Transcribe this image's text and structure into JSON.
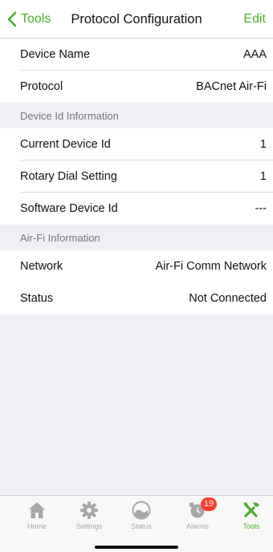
{
  "nav": {
    "back_label": "Tools",
    "title": "Protocol Configuration",
    "edit_label": "Edit"
  },
  "rows_top": [
    {
      "label": "Device Name",
      "value": "AAA"
    },
    {
      "label": "Protocol",
      "value": "BACnet Air-Fi"
    }
  ],
  "device_id_section": {
    "header": "Device Id Information",
    "rows": [
      {
        "label": "Current Device Id",
        "value": "1"
      },
      {
        "label": "Rotary Dial Setting",
        "value": "1"
      },
      {
        "label": "Software Device Id",
        "value": "---"
      }
    ]
  },
  "airfi_section": {
    "header": "Air-Fi Information",
    "rows": [
      {
        "label": "Network",
        "value": "Air-Fi Comm Network"
      },
      {
        "label": "Status",
        "value": "Not Connected"
      }
    ]
  },
  "tab_bar": {
    "tabs": [
      {
        "label": "Home",
        "icon": "home-icon"
      },
      {
        "label": "Settings",
        "icon": "gear-icon"
      },
      {
        "label": "Status",
        "icon": "gauge-icon"
      },
      {
        "label": "Alarms",
        "icon": "alarm-clock-icon",
        "badge": "19"
      },
      {
        "label": "Tools",
        "icon": "tools-icon"
      }
    ],
    "active_index": 4
  },
  "colors": {
    "accent": "#4caf2b",
    "badge": "#ff3b30",
    "inactive_tab": "#a7a7a7",
    "section_bg": "#efeff4"
  }
}
